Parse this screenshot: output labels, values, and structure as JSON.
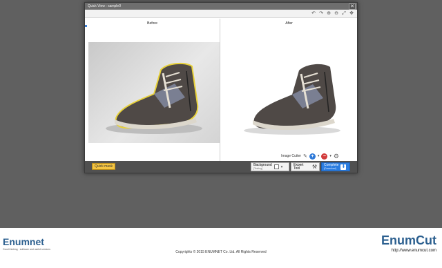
{
  "window": {
    "title": "Quick View : sample0",
    "close_glyph": "✕"
  },
  "toolbar": {
    "icons": [
      "undo-icon",
      "redo-icon",
      "zoom-in-icon",
      "zoom-out-icon",
      "fit-icon",
      "move-icon"
    ],
    "glyphs": [
      "↶",
      "↷",
      "⊕",
      "⊖",
      "⤢",
      "✥"
    ]
  },
  "panes": {
    "before_label": "Before",
    "after_label": "After"
  },
  "cutter": {
    "label": "Image Cutter",
    "add_glyph": "+",
    "remove_glyph": "−",
    "caret": "▾",
    "gear_glyph": "⚙",
    "pen_glyph": "✎"
  },
  "footer_buttons": {
    "quick_mask": "Quick mask",
    "background_label": "Background",
    "background_sub": "[Testing]",
    "expert_label": "Expert Tool",
    "complete_label": "Complete",
    "complete_sub": "(Download)",
    "download_glyph": "⬇",
    "wrench_glyph": "⚒"
  },
  "page_footer": {
    "left_brand": "Enumnet",
    "left_tagline": "Good thinking · software and useful services",
    "copyright": "Copyrights ©  2015 ENUMNET Co. Ltd. All Rights Reserved",
    "right_brand": "EnumCut",
    "url": "http://www.enumcut.com"
  },
  "colors": {
    "accent_blue": "#2b7de0",
    "quick_mask_yellow": "#f5c542",
    "selection_outline": "#e8d23a"
  }
}
